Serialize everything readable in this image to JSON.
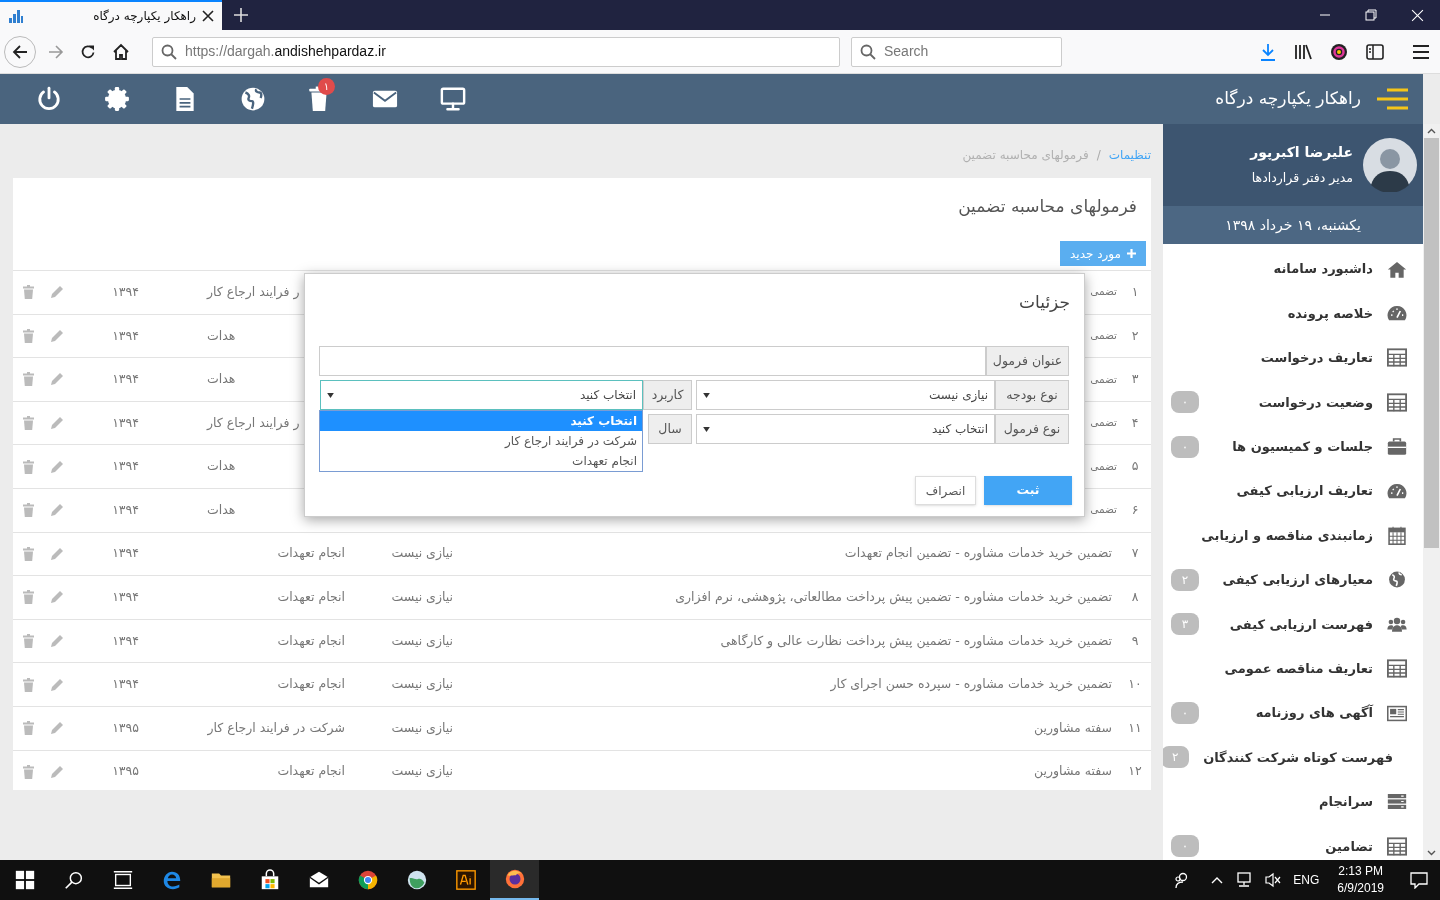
{
  "browser": {
    "tab_title": "راهکار یکپارچه درگاه",
    "url_prefix": "https://dargah.",
    "url_domain": "andishehpardaz.ir",
    "search_placeholder": "Search"
  },
  "app_header": {
    "title": "راهکار یکپارچه درگاه",
    "toolbar_badge": "۱"
  },
  "user": {
    "name": "علیرضا اکبرپور",
    "role": "مدیر دفتر قراردادها",
    "date": "یکشنبه، ۱۹ خرداد ۱۳۹۸"
  },
  "menu": [
    {
      "label": "داشبورد سامانه"
    },
    {
      "label": "خلاصه پرونده"
    },
    {
      "label": "تعاریف درخواست"
    },
    {
      "label": "وضعیت درخواست",
      "badge": "۰"
    },
    {
      "label": "جلسات و کمیسیون ها",
      "badge": "۰"
    },
    {
      "label": "تعاریف ارزیابی کیفی"
    },
    {
      "label": "زمانبندی مناقصه و ارزیابی"
    },
    {
      "label": "معیارهای ارزیابی کیفی",
      "badge": "۲"
    },
    {
      "label": "فهرست ارزیابی کیفی",
      "badge": "۳"
    },
    {
      "label": "تعاریف مناقصه عمومی"
    },
    {
      "label": "آگهی های روزنامه",
      "badge": "۰"
    },
    {
      "label": "فهرست کوتاه شرکت کنندگان",
      "badge": "۲"
    },
    {
      "label": "سرانجام"
    },
    {
      "label": "تضامین",
      "badge": "۰"
    }
  ],
  "breadcrumb": {
    "items": [
      "تنظیمات",
      "فرمولهای محاسبه تضمین"
    ],
    "separator": "/"
  },
  "card": {
    "title": "فرمولهای محاسبه تضمین",
    "new_button": "مورد جدید",
    "rows": [
      {
        "kind": "partial",
        "number": "۱",
        "title": "تضمی",
        "usage": "ر فرایند ارجاع کار",
        "year": "۱۳۹۴"
      },
      {
        "kind": "partial",
        "number": "۲",
        "title": "تضمی",
        "usage": "هدات",
        "year": "۱۳۹۴"
      },
      {
        "kind": "partial",
        "number": "۳",
        "title": "تضمی",
        "usage": "هدات",
        "year": "۱۳۹۴"
      },
      {
        "kind": "partial",
        "number": "۴",
        "title": "تضمی",
        "usage": "ر فرایند ارجاع کار",
        "year": "۱۳۹۴"
      },
      {
        "kind": "partial",
        "number": "۵",
        "title": "تضمی",
        "usage": "هدات",
        "year": "۱۳۹۴"
      },
      {
        "kind": "partial",
        "number": "۶",
        "title": "تضمی",
        "usage": "هدات",
        "year": "۱۳۹۴"
      },
      {
        "kind": "full",
        "number": "۷",
        "title": "تضمین خرید خدمات مشاوره - تضمین انجام تعهدات",
        "budget": "نیازی نیست",
        "usage": "انجام تعهدات",
        "year": "۱۳۹۴"
      },
      {
        "kind": "full",
        "number": "۸",
        "title": "تضمین خرید خدمات مشاوره - تضمین پیش پرداخت مطالعاتی، پژوهشی، نرم افزاری",
        "budget": "نیازی نیست",
        "usage": "انجام تعهدات",
        "year": "۱۳۹۴"
      },
      {
        "kind": "full",
        "number": "۹",
        "title": "تضمین خرید خدمات مشاوره - تضمین پیش پرداخت نظارت عالی و کارگاهی",
        "budget": "نیازی نیست",
        "usage": "انجام تعهدات",
        "year": "۱۳۹۴"
      },
      {
        "kind": "full",
        "number": "۱۰",
        "title": "تضمین خرید خدمات مشاوره - سپرده حسن اجرای کار",
        "budget": "نیازی نیست",
        "usage": "انجام تعهدات",
        "year": "۱۳۹۴"
      },
      {
        "kind": "full",
        "number": "۱۱",
        "title": "سفته مشاورین",
        "budget": "نیازی نیست",
        "usage": "شرکت در فرایند ارجاع کار",
        "year": "۱۳۹۵"
      },
      {
        "kind": "full",
        "number": "۱۲",
        "title": "سفته مشاورین",
        "budget": "نیازی نیست",
        "usage": "انجام تعهدات",
        "year": "۱۳۹۵"
      }
    ]
  },
  "modal": {
    "title": "جزئیات",
    "title_field": {
      "label": "عنوان فرمول"
    },
    "budget_type": {
      "label": "نوع بودجه",
      "value": "نیازی نیست",
      "focused": false
    },
    "usage": {
      "label": "کاربرد",
      "value": "انتخاب کنید",
      "focused": true
    },
    "formula_type": {
      "label": "نوع فرمول",
      "value": "انتخاب کنید",
      "focused": false
    },
    "year": {
      "label": "سال"
    },
    "dropdown": [
      {
        "label": "انتخاب کنید",
        "selected": true
      },
      {
        "label": "شرکت در فرایند ارجاع کار",
        "selected": false
      },
      {
        "label": "انجام تعهدات",
        "selected": false
      }
    ],
    "save_button": "ثبت",
    "cancel_button": "انصراف"
  },
  "taskbar": {
    "language": "ENG",
    "time": "2:13 PM",
    "date": "6/9/2019"
  }
}
